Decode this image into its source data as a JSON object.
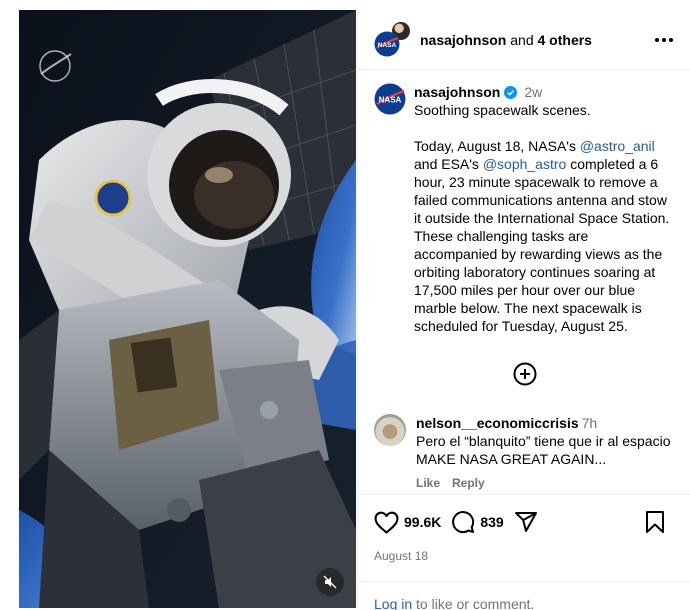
{
  "header": {
    "username": "nasajohnson",
    "connector": " and ",
    "others": "4 others",
    "more_icon": "ellipsis-icon"
  },
  "caption": {
    "username": "nasajohnson",
    "time": "2w",
    "line1": "Soothing spacewalk scenes.",
    "p2_start": "Today, August 18, NASA's ",
    "mention1": "@astro_anil",
    "p2_mid": " and ESA's ",
    "mention2": "@soph_astro",
    "p2_end": " completed a 6 hour, 23 minute spacewalk to remove a failed communications antenna and stow it outside the International Space Station. These challenging tasks are accompanied by rewarding views as the orbiting laboratory continues soaring at 17,500 miles per hour over our blue marble below. The next spacewalk is scheduled for Tuesday, August 25."
  },
  "load_more_icon": "plus-circle-icon",
  "comment": {
    "username": "nelson__economiccrisis",
    "time": "7h",
    "text": "Pero el “blanquito” tiene que ir al espacio MAKE NASA GREAT AGAIN...",
    "like_label": "Like",
    "reply_label": "Reply"
  },
  "actions": {
    "likes": "99.6K",
    "comments": "839",
    "date": "August 18"
  },
  "login": {
    "link": "Log in",
    "rest": " to like or comment."
  },
  "colors": {
    "verified": "#0095f6",
    "link": "#2b60b8",
    "muted": "#737373"
  }
}
